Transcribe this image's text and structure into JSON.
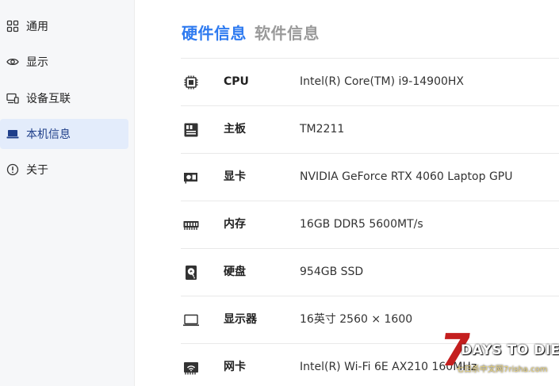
{
  "sidebar": {
    "items": [
      {
        "label": "通用",
        "icon": "grid-icon",
        "active": false
      },
      {
        "label": "显示",
        "icon": "eye-icon",
        "active": false
      },
      {
        "label": "设备互联",
        "icon": "devices-icon",
        "active": false
      },
      {
        "label": "本机信息",
        "icon": "laptop-icon",
        "active": true
      },
      {
        "label": "关于",
        "icon": "info-icon",
        "active": false
      }
    ]
  },
  "tabs": [
    {
      "label": "硬件信息",
      "active": true
    },
    {
      "label": "软件信息",
      "active": false
    }
  ],
  "hardware": [
    {
      "icon": "cpu-icon",
      "label": "CPU",
      "value": "Intel(R) Core(TM) i9-14900HX"
    },
    {
      "icon": "motherboard-icon",
      "label": "主板",
      "value": "TM2211"
    },
    {
      "icon": "gpu-icon",
      "label": "显卡",
      "value": "NVIDIA GeForce RTX 4060 Laptop GPU"
    },
    {
      "icon": "memory-icon",
      "label": "内存",
      "value": "16GB DDR5 5600MT/s"
    },
    {
      "icon": "disk-icon",
      "label": "硬盘",
      "value": "954GB SSD"
    },
    {
      "icon": "monitor-icon",
      "label": "显示器",
      "value": "16英寸 2560 × 1600"
    },
    {
      "icon": "network-card-icon",
      "label": "网卡",
      "value": "Intel(R) Wi-Fi 6E AX210 160MHz"
    }
  ],
  "watermark": {
    "seven": "7",
    "title": "DAYS TO DIE",
    "subtitle": "七日杀中文网7risha.com"
  },
  "colors": {
    "accent": "#2f7bf0",
    "active_nav_bg": "#e3ecfb",
    "sidebar_bg": "#f6f7f9"
  }
}
